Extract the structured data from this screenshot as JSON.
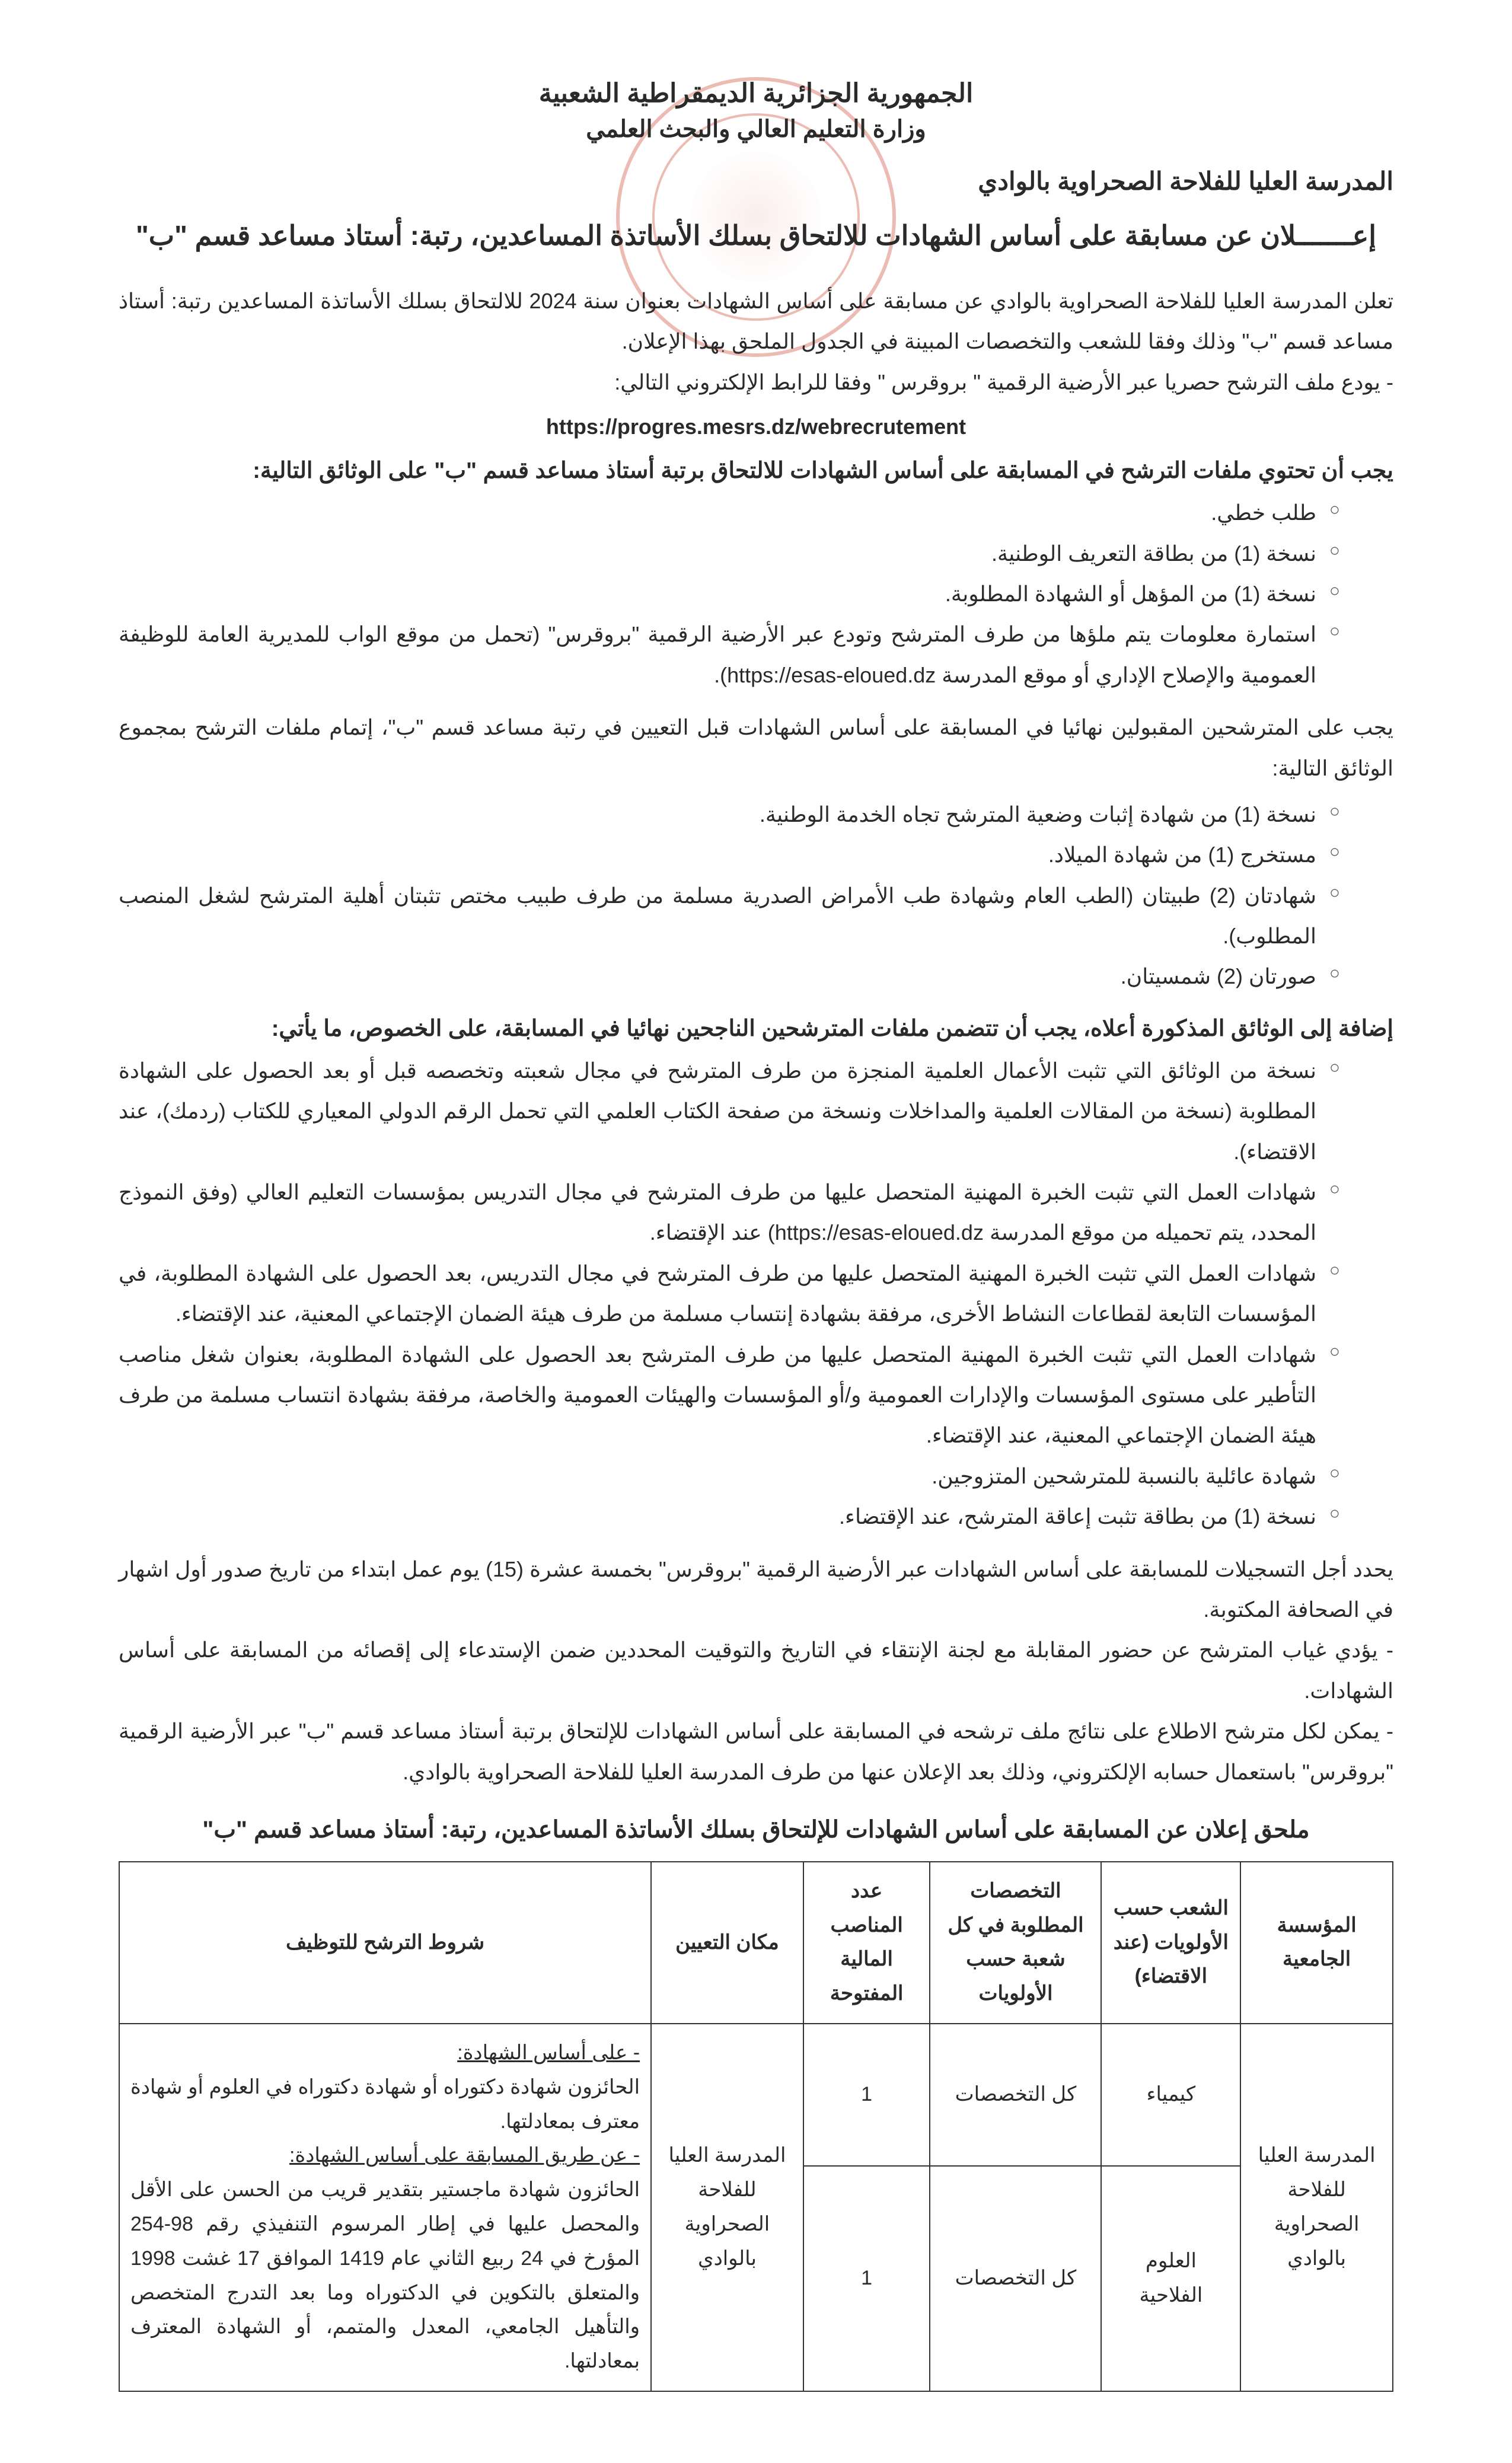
{
  "header": {
    "republic": "الجمهورية الجزائرية الديمقراطية الشعبية",
    "ministry": "وزارة التعليم العالي والبحث العلمي",
    "school": "المدرسة العليا للفلاحة الصحراوية بالوادي"
  },
  "title": "إعـــــــلان عن مسابقة على أساس الشهادات للالتحاق بسلك الأساتذة المساعدين، رتبة: أستاذ مساعد قسم \"ب\"",
  "intro": {
    "p1": "تعلن المدرسة العليا للفلاحة الصحراوية بالوادي عن مسابقة على أساس الشهادات بعنوان سنة 2024 للالتحاق بسلك الأساتذة المساعدين رتبة: أستاذ مساعد قسم \"ب\" وذلك وفقا للشعب والتخصصات المبينة في الجدول الملحق بهذا الإعلان.",
    "p2": "- يودع ملف الترشح حصريا عبر الأرضية الرقمية \" بروقرس \" وفقا للرابط الإلكتروني التالي:"
  },
  "link": "https://progres.mesrs.dz/webrecrutement",
  "req_header": "يجب أن تحتوي ملفات الترشح في المسابقة على أساس الشهادات للالتحاق برتبة أستاذ مساعد قسم \"ب\" على الوثائق التالية:",
  "req_list": [
    "طلب خطي.",
    "نسخة (1) من بطاقة التعريف الوطنية.",
    "نسخة (1) من المؤهل أو الشهادة المطلوبة.",
    "استمارة معلومات يتم ملؤها من طرف المترشح وتودع عبر الأرضية الرقمية \"بروقرس\" (تحمل من موقع الواب للمديرية العامة للوظيفة العمومية والإصلاح الإداري أو موقع المدرسة https://esas-eloued.dz)."
  ],
  "final_intro": "يجب على المترشحين المقبولين نهائيا في المسابقة على أساس الشهادات قبل التعيين في رتبة مساعد قسم \"ب\"، إتمام ملفات الترشح بمجموع الوثائق التالية:",
  "final_list": [
    "نسخة (1) من شهادة إثبات وضعية المترشح تجاه الخدمة الوطنية.",
    "مستخرج (1) من شهادة الميلاد.",
    "شهادتان (2) طبيتان (الطب العام وشهادة طب الأمراض الصدرية مسلمة من طرف طبيب مختص تثبتان أهلية المترشح لشغل المنصب المطلوب).",
    "صورتان (2) شمسيتان."
  ],
  "success_header": "إضافة إلى الوثائق المذكورة أعلاه، يجب أن تتضمن ملفات المترشحين الناجحين نهائيا في المسابقة، على الخصوص، ما يأتي:",
  "success_list": [
    "نسخة من الوثائق التي تثبت الأعمال العلمية المنجزة من طرف المترشح في مجال شعبته وتخصصه قبل أو بعد الحصول على الشهادة المطلوبة (نسخة من المقالات العلمية والمداخلات ونسخة من صفحة الكتاب العلمي التي تحمل الرقم الدولي المعياري للكتاب (ردمك)، عند الاقتضاء).",
    "شهادات العمل التي تثبت الخبرة المهنية المتحصل عليها من طرف المترشح في مجال التدريس بمؤسسات التعليم العالي (وفق النموذج المحدد، يتم تحميله من موقع المدرسة https://esas-eloued.dz) عند الإقتضاء.",
    "شهادات العمل التي تثبت الخبرة المهنية المتحصل عليها من طرف المترشح في مجال التدريس، بعد الحصول على الشهادة المطلوبة، في المؤسسات التابعة لقطاعات النشاط الأخرى، مرفقة بشهادة إنتساب مسلمة من طرف هيئة الضمان الإجتماعي المعنية، عند الإقتضاء.",
    "شهادات العمل التي تثبت الخبرة المهنية المتحصل عليها من طرف المترشح بعد الحصول على الشهادة المطلوبة، بعنوان شغل مناصب التأطير على مستوى المؤسسات والإدارات العمومية و/أو المؤسسات والهيئات العمومية والخاصة، مرفقة بشهادة انتساب مسلمة من طرف هيئة الضمان الإجتماعي المعنية، عند الإقتضاء.",
    "شهادة عائلية بالنسبة للمترشحين المتزوجين.",
    "نسخة (1) من بطاقة تثبت إعاقة المترشح، عند الإقتضاء."
  ],
  "notes": {
    "n1": "يحدد أجل التسجيلات للمسابقة على أساس الشهادات عبر الأرضية الرقمية \"بروقرس\" بخمسة عشرة (15) يوم عمل ابتداء من تاريخ صدور أول اشهار في الصحافة المكتوبة.",
    "n2": "- يؤدي غياب المترشح عن حضور المقابلة مع لجنة الإنتقاء في التاريخ والتوقيت المحددين ضمن الإستدعاء إلى إقصائه من المسابقة على أساس الشهادات.",
    "n3": "- يمكن لكل مترشح الاطلاع على نتائج ملف ترشحه في المسابقة على أساس الشهادات للإلتحاق برتبة أستاذ مساعد قسم \"ب\" عبر الأرضية الرقمية \"بروقرس\" باستعمال حسابه الإلكتروني، وذلك بعد الإعلان عنها من طرف المدرسة العليا للفلاحة الصحراوية بالوادي."
  },
  "annex": {
    "title": "ملحق إعلان عن المسابقة على أساس الشهادات للإلتحاق بسلك الأساتذة المساعدين، رتبة: أستاذ مساعد قسم \"ب\"",
    "headers": {
      "institution": "المؤسسة الجامعية",
      "branch": "الشعب حسب الأولويات (عند الاقتضاء)",
      "spec": "التخصصات المطلوبة في كل شعبة حسب الأولويات",
      "posts": "عدد المناصب المالية المفتوحة",
      "location": "مكان التعيين",
      "conditions": "شروط الترشح للتوظيف"
    },
    "institution": "المدرسة العليا للفلاحة الصحراوية بالوادي",
    "location": "المدرسة العليا للفلاحة الصحراوية بالوادي",
    "rows": [
      {
        "branch": "كيمياء",
        "spec": "كل التخصصات",
        "posts": "1"
      },
      {
        "branch": "العلوم الفلاحية",
        "spec": "كل التخصصات",
        "posts": "1"
      }
    ],
    "conditions": {
      "lead1": "- على أساس الشهادة:",
      "text1": "الحائزون شهادة دكتوراه أو شهادة دكتوراه في العلوم أو شهادة معترف بمعادلتها.",
      "lead2": "- عن طريق المسابقة على أساس الشهادة:",
      "text2": "الحائزون شهادة ماجستير بتقدير قريب من الحسن على الأقل والمحصل عليها في إطار المرسوم التنفيذي رقم 98-254 المؤرخ في 24 ربيع الثاني عام 1419 الموافق 17 غشت 1998 والمتعلق بالتكوين في الدكتوراه وما بعد التدرج المتخصص والتأهيل الجامعي، المعدل والمتمم، أو الشهادة المعترف بمعادلتها."
    }
  }
}
